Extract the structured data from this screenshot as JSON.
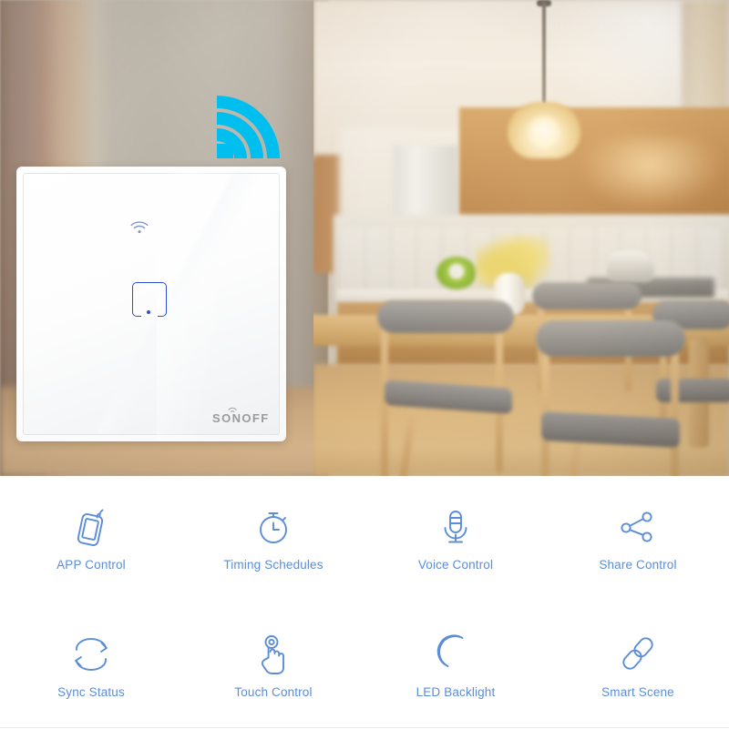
{
  "hero": {
    "scene_description": "Blurred modern kitchen and dining room interior",
    "wifi_broadcast_icon": "wifi-broadcast-icon",
    "wifi_accent_color": "#00BFEF",
    "objects": [
      "pendant-lamp",
      "wooden-upper-cabinets",
      "refrigerator",
      "kitchen-counter",
      "dining-table",
      "dining-chairs",
      "flower-vase",
      "wood-floor"
    ]
  },
  "switch": {
    "brand": "SONOFF",
    "panel_color": "#ffffff",
    "key_outline_color": "#2c4fd6",
    "wifi_indicator_icon": "wifi-indicator-icon",
    "touch_key_icon": "touch-key-square-icon",
    "logo_icon": "sonoff-logo-icon"
  },
  "features": {
    "label_color": "#5b8dd9",
    "icon_color": "#5b8dd9",
    "items": [
      {
        "label": "APP Control",
        "icon": "phone-signal-icon"
      },
      {
        "label": "Timing Schedules",
        "icon": "stopwatch-icon"
      },
      {
        "label": "Voice Control",
        "icon": "microphone-icon"
      },
      {
        "label": "Share Control",
        "icon": "share-nodes-icon"
      },
      {
        "label": "Sync Status",
        "icon": "sync-arrows-icon"
      },
      {
        "label": "Touch Control",
        "icon": "hand-tap-icon"
      },
      {
        "label": "LED Backlight",
        "icon": "crescent-moon-icon"
      },
      {
        "label": "Smart Scene",
        "icon": "chain-link-icon"
      }
    ]
  }
}
